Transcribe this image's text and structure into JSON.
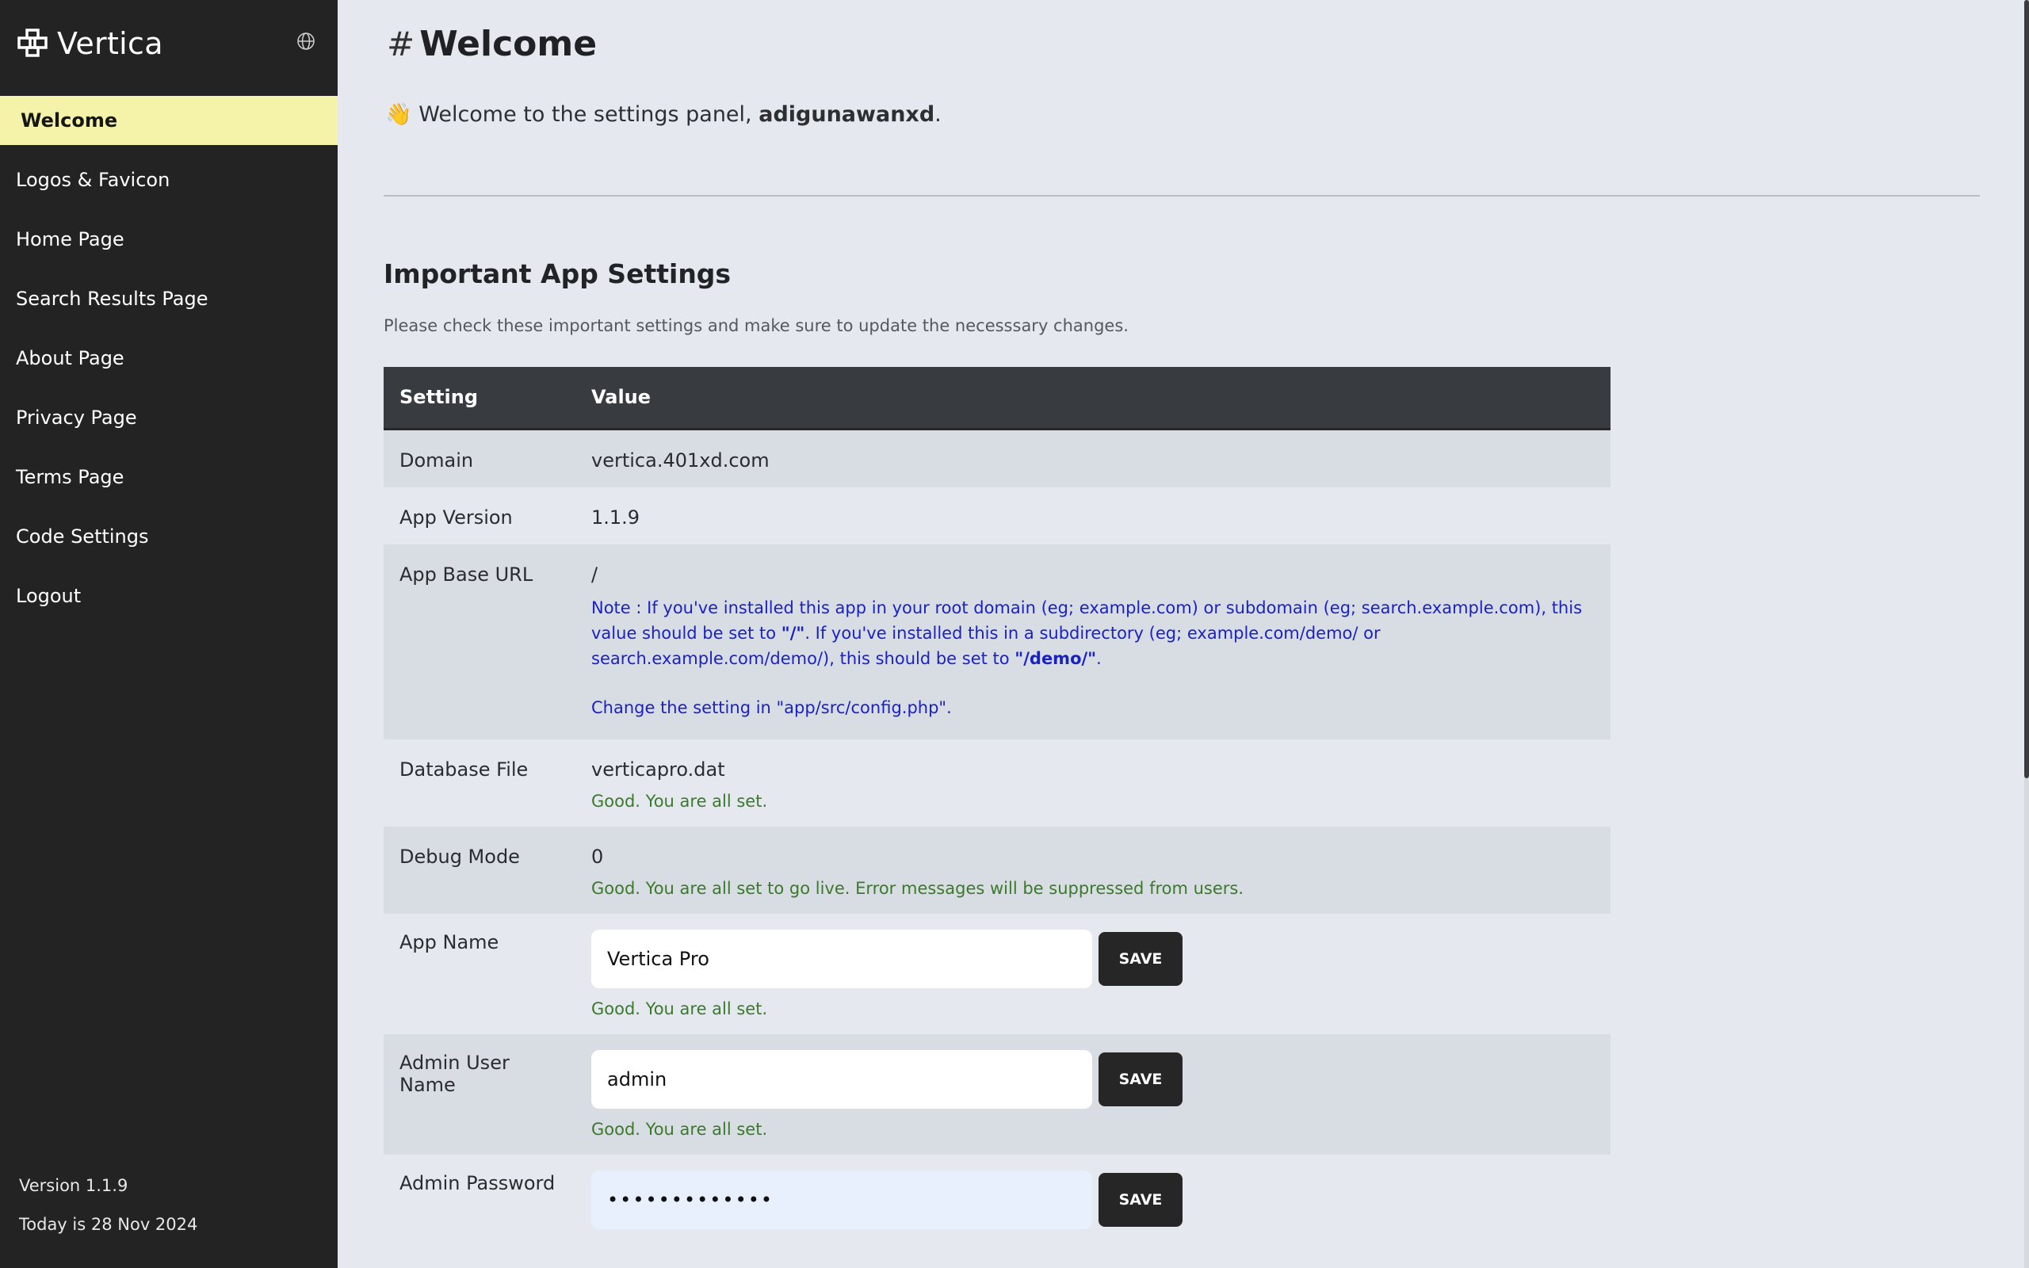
{
  "brand": {
    "name": "Vertica"
  },
  "sidebar": {
    "items": [
      {
        "label": "Welcome",
        "active": true
      },
      {
        "label": "Logos & Favicon"
      },
      {
        "label": "Home Page"
      },
      {
        "label": "Search Results Page"
      },
      {
        "label": "About Page"
      },
      {
        "label": "Privacy Page"
      },
      {
        "label": "Terms Page"
      },
      {
        "label": "Code Settings"
      },
      {
        "label": "Logout"
      }
    ],
    "footer": {
      "version": "Version 1.1.9",
      "date": "Today is 28 Nov 2024"
    }
  },
  "header": {
    "hash": "#",
    "title": "Welcome",
    "wave_emoji": "👋",
    "welcome_prefix": "Welcome to the settings panel,",
    "username": "adigunawanxd",
    "welcome_suffix": "."
  },
  "section": {
    "title": "Important App Settings",
    "description": "Please check these important settings and make sure to update the necesssary changes."
  },
  "table": {
    "headers": {
      "setting": "Setting",
      "value": "Value"
    },
    "domain": {
      "label": "Domain",
      "value": "vertica.401xd.com"
    },
    "app_version": {
      "label": "App Version",
      "value": "1.1.9"
    },
    "base_url": {
      "label": "App Base URL",
      "value": "/",
      "note_1": "Note : If you've installed this app in your root domain (eg; example.com) or subdomain (eg; search.example.com), this value should be set to ",
      "note_1_bold": "\"/\"",
      "note_2": ". If you've installed this in a subdirectory (eg; example.com/demo/ or search.example.com/demo/), this should be set to ",
      "note_2_bold": "\"/demo/\"",
      "note_3": ".",
      "note_change": "Change the setting in \"app/src/config.php\"."
    },
    "database": {
      "label": "Database File",
      "value": "verticapro.dat",
      "status": "Good. You are all set."
    },
    "debug": {
      "label": "Debug Mode",
      "value": "0",
      "status": "Good. You are all set to go live. Error messages will be suppressed from users."
    },
    "app_name": {
      "label": "App Name",
      "value": "Vertica Pro",
      "save": "SAVE",
      "status": "Good. You are all set."
    },
    "admin_user": {
      "label": "Admin User Name",
      "value": "admin",
      "save": "SAVE",
      "status": "Good. You are all set."
    },
    "admin_password": {
      "label": "Admin Password",
      "value": "•••••••••••••",
      "save": "SAVE"
    }
  },
  "colors": {
    "sidebar_bg": "#232323",
    "active_item_bg": "#f4f3a9",
    "main_bg": "#e5e9ef",
    "table_header_bg": "#383b40",
    "note_blue": "#1a22c4",
    "good_green": "#3a7a2a"
  }
}
